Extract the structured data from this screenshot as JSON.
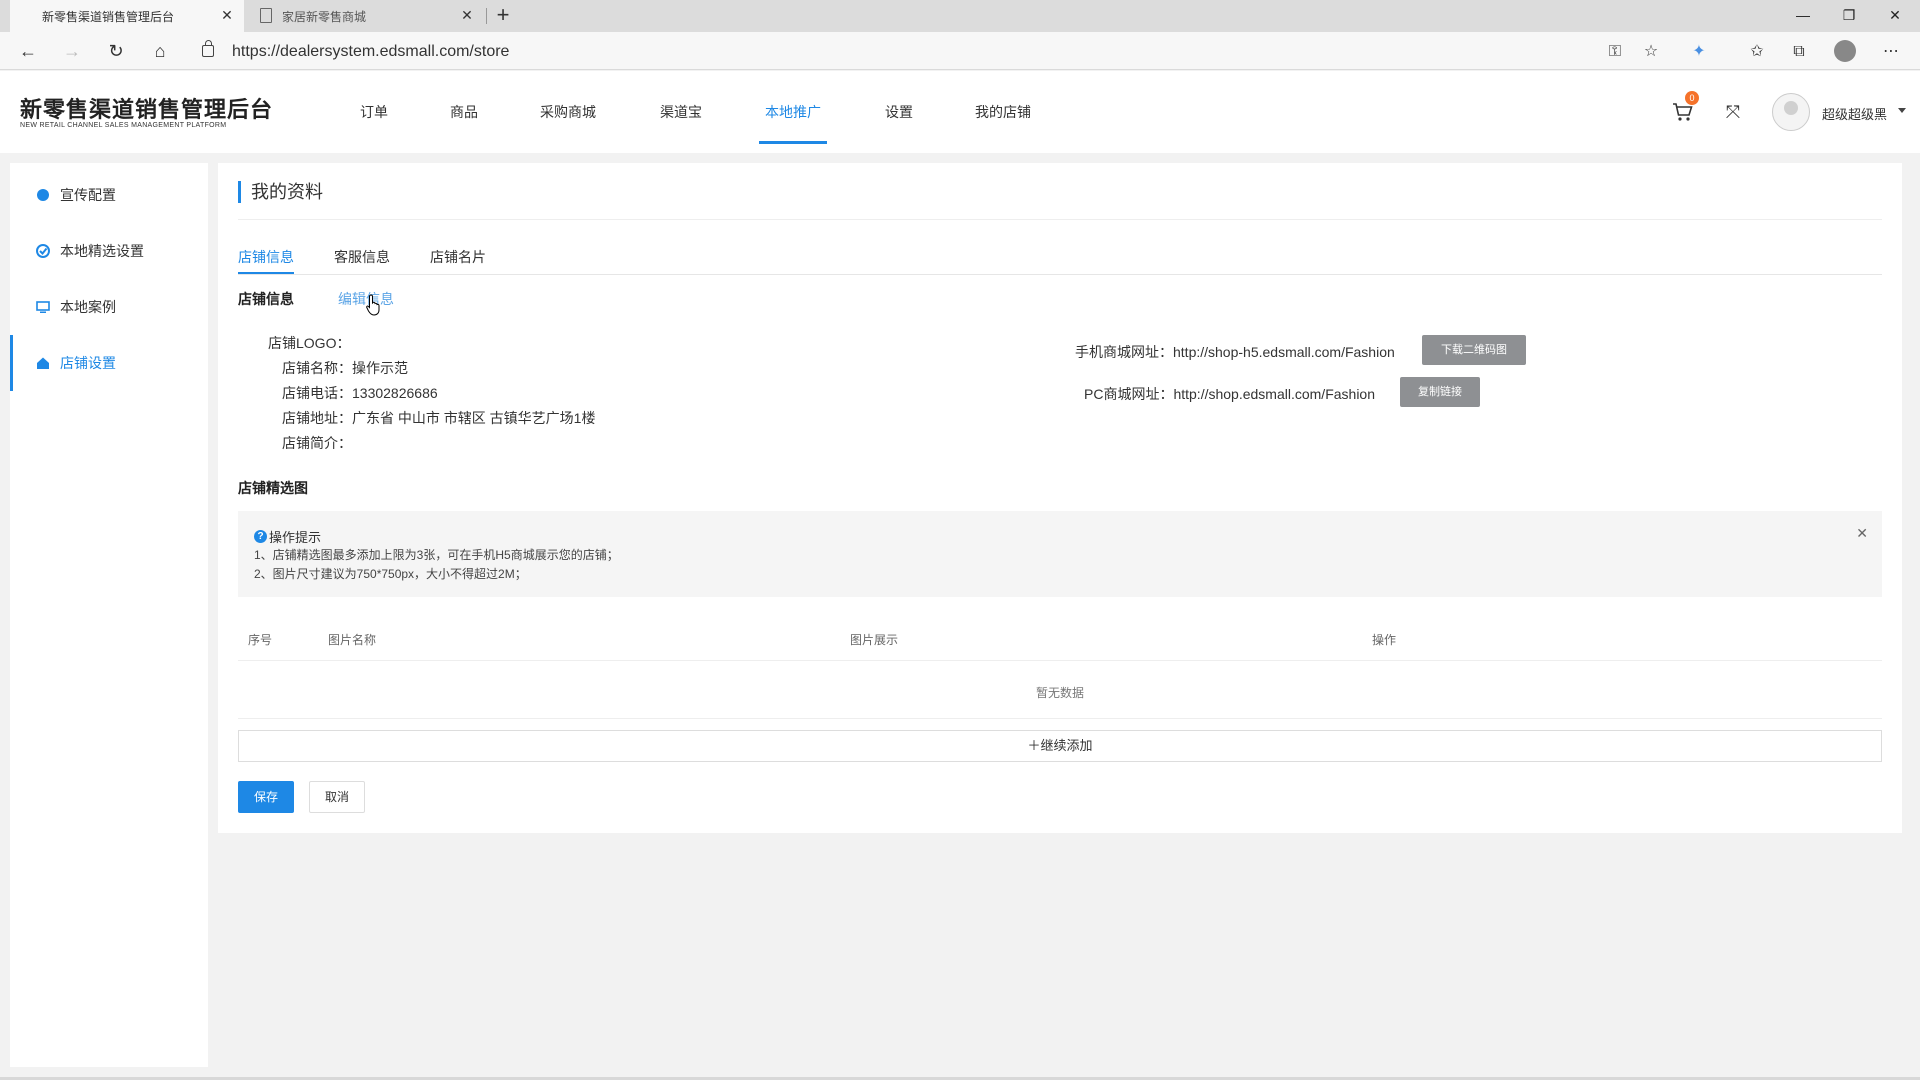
{
  "browser": {
    "tabs": [
      {
        "title": "新零售渠道销售管理后台",
        "active": true
      },
      {
        "title": "家居新零售商城",
        "active": false
      }
    ],
    "url": "https://dealersystem.edsmall.com/store"
  },
  "app": {
    "brand_title": "新零售渠道销售管理后台",
    "brand_subtitle": "NEW RETAIL CHANNEL SALES MANAGEMENT PLATFORM",
    "nav": [
      "订单",
      "商品",
      "采购商城",
      "渠道宝",
      "本地推广",
      "设置",
      "我的店铺"
    ],
    "active_nav": "本地推广",
    "cart_count": "0",
    "username": "超级超级黑"
  },
  "sidebar": {
    "items": [
      {
        "label": "宣传配置",
        "icon": "megaphone-icon"
      },
      {
        "label": "本地精选设置",
        "icon": "check-circle-icon"
      },
      {
        "label": "本地案例",
        "icon": "monitor-icon"
      },
      {
        "label": "店铺设置",
        "icon": "home-icon"
      }
    ],
    "active": "店铺设置"
  },
  "main": {
    "page_title": "我的资料",
    "subtabs": [
      "店铺信息",
      "客服信息",
      "店铺名片"
    ],
    "section_store_info": "店铺信息",
    "edit_link": "编辑信息",
    "store_fields": [
      {
        "label": "店铺LOGO：",
        "value": ""
      },
      {
        "label": "店铺名称：",
        "value": "操作示范"
      },
      {
        "label": "店铺电话：",
        "value": "13302826686"
      },
      {
        "label": "店铺地址：",
        "value": "广东省 中山市 市辖区 古镇华艺广场1楼"
      },
      {
        "label": "店铺简介：",
        "value": ""
      }
    ],
    "mobile_url_label": "手机商城网址：",
    "mobile_url": "http://shop-h5.edsmall.com/Fashion",
    "download_qr_label": "下载二维码图",
    "pc_url_label": "PC商城网址：",
    "pc_url": "http://shop.edsmall.com/Fashion",
    "copy_link_label": "复制链接",
    "section_featured": "店铺精选图",
    "tip": {
      "title": "操作提示",
      "lines": [
        "1、店铺精选图最多添加上限为3张，可在手机H5商城展示您的店铺；",
        "2、图片尺寸建议为750*750px，大小不得超过2M；"
      ]
    },
    "table": {
      "columns": [
        "序号",
        "图片名称",
        "图片展示",
        "操作"
      ],
      "empty_text": "暂无数据"
    },
    "add_more_label": "＋继续添加",
    "save_label": "保存",
    "cancel_label": "取消"
  },
  "colors": {
    "accent": "#1e88e5",
    "gray_button": "#8e9093",
    "badge": "#f5722a"
  }
}
